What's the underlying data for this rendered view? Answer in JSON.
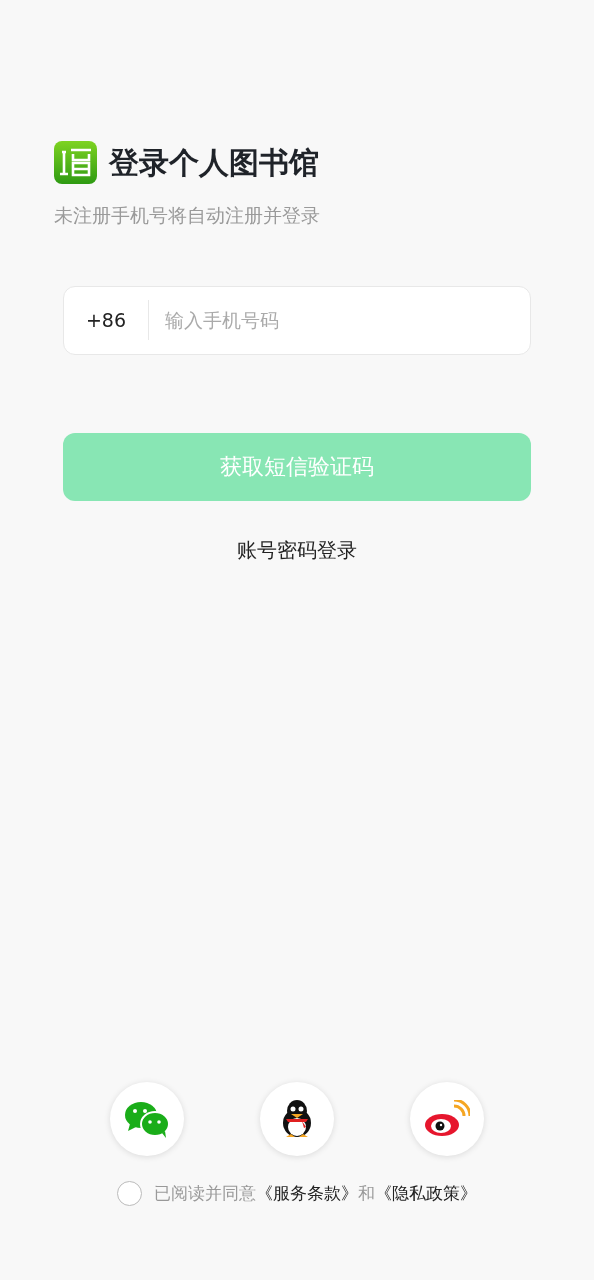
{
  "header": {
    "title": "登录个人图书馆",
    "subtitle": "未注册手机号将自动注册并登录"
  },
  "phone_field": {
    "country_code": "+86",
    "placeholder": "输入手机号码"
  },
  "submit_button": {
    "label": "获取短信验证码",
    "disabled": true
  },
  "alt_login_link": "账号密码登录",
  "social_logins": [
    {
      "kind": "wechat"
    },
    {
      "kind": "qq"
    },
    {
      "kind": "weibo"
    }
  ],
  "agreement": {
    "checked": false,
    "parts": [
      {
        "kind": "text",
        "text": "已阅读并同意"
      },
      {
        "kind": "link",
        "text": "《服务条款》"
      },
      {
        "kind": "text",
        "text": "和"
      },
      {
        "kind": "link",
        "text": "《隐私政策》"
      }
    ]
  }
}
